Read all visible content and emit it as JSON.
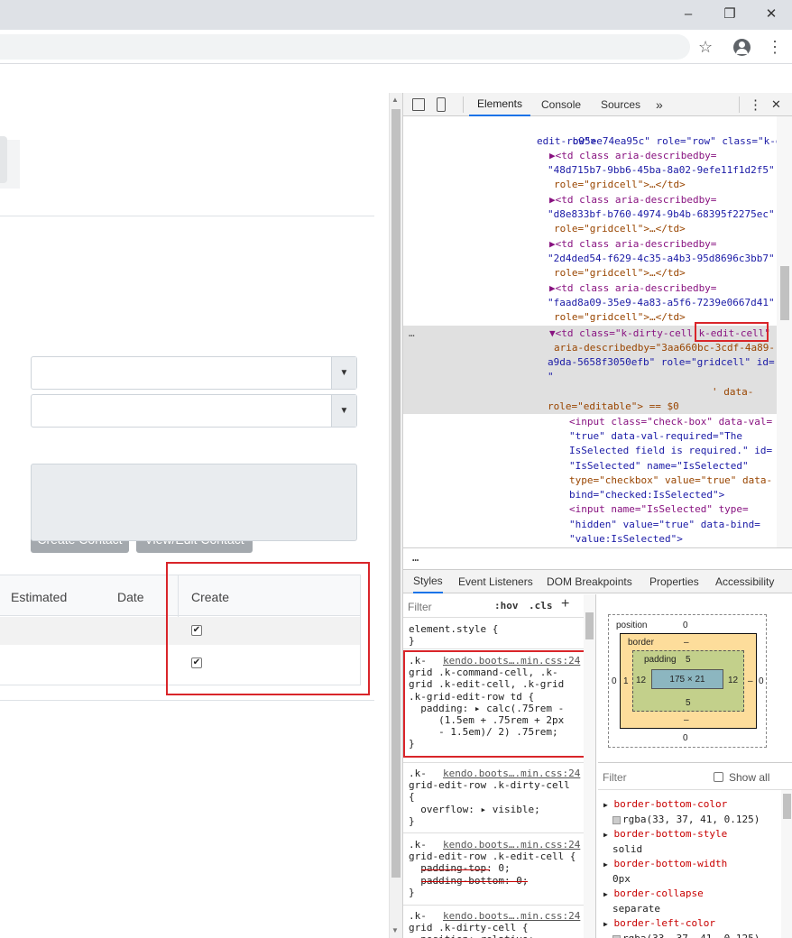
{
  "window": {
    "minimize": "–",
    "restore": "❐",
    "close": "✕"
  },
  "toolbar": {
    "star_icon": "☆",
    "menu_icon": "⋮"
  },
  "page": {
    "buttons": {
      "create_contact": "Create Contact",
      "view_edit_contact": "View/Edit Contact"
    },
    "grid": {
      "headers": [
        "Estimated",
        "Date",
        "Create"
      ],
      "rows": [
        {
          "create_checked": true
        },
        {
          "create_checked": true
        }
      ]
    }
  },
  "devtools": {
    "tabs": [
      "Elements",
      "Console",
      "Sources"
    ],
    "more": "»",
    "kebab": "⋮",
    "close": "✕",
    "elements": {
      "lines": [
        {
          "text": "b95ee74ea95c\" role=\"row\" class=\"k-grid-"
        },
        {
          "text": "edit-row\">"
        },
        {
          "text": "▶<td class aria-describedby="
        },
        {
          "text": "\"48d715b7-9bb6-45ba-8a02-9efe11f1d2f5\""
        },
        {
          "text": "role=\"gridcell\">…</td>"
        },
        {
          "text": "▶<td class aria-describedby="
        },
        {
          "text": "\"d8e833bf-b760-4974-9b4b-68395f2275ec\""
        },
        {
          "text": "role=\"gridcell\">…</td>"
        },
        {
          "text": "▶<td class aria-describedby="
        },
        {
          "text": "\"2d4ded54-f629-4c35-a4b3-95d8696c3bb7\""
        },
        {
          "text": "role=\"gridcell\">…</td>"
        },
        {
          "text": "▶<td class aria-describedby="
        },
        {
          "text": "\"faad8a09-35e9-4a83-a5f6-7239e0667d41\""
        },
        {
          "text": "role=\"gridcell\">…</td>"
        },
        {
          "text": "▼<td class=\"k-dirty-cell k-edit-cell\""
        },
        {
          "text": "aria-describedby=\"3aa660bc-3cdf-4a89-"
        },
        {
          "text": "a9da-5658f3050efb\" role=\"gridcell\" id="
        },
        {
          "text": "\""
        },
        {
          "text": "' data-"
        },
        {
          "text": "role=\"editable\"> == $0"
        },
        {
          "text": "<input class=\"check-box\" data-val="
        },
        {
          "text": "\"true\" data-val-required=\"The"
        },
        {
          "text": "IsSelected field is required.\" id="
        },
        {
          "text": "\"IsSelected\" name=\"IsSelected\""
        },
        {
          "text": "type=\"checkbox\" value=\"true\" data-"
        },
        {
          "text": "bind=\"checked:IsSelected\">"
        },
        {
          "text": "<input name=\"IsSelected\" type="
        },
        {
          "text": "\"hidden\" value=\"true\" data-bind="
        },
        {
          "text": "\"value:IsSelected\">"
        }
      ],
      "ellipsis": "…"
    },
    "subtabs": [
      "Styles",
      "Event Listeners",
      "DOM Breakpoints",
      "Properties",
      "Accessibility"
    ],
    "filter_placeholder": "Filter",
    "hov": ":hov",
    "cls": ".cls",
    "plus": "+",
    "styles": [
      {
        "text": "element.style {\n}"
      },
      {
        "src": "kendo.boots….min.css:24",
        "text": ".k-\ngrid .k-command-cell, .k-\ngrid .k-edit-cell, .k-grid\n.k-grid-edit-row td {\n  padding: ▸ calc(.75rem -\n     (1.5em + .75rem + 2px\n     - 1.5em)/ 2) .75rem;\n}"
      },
      {
        "src": "kendo.boots….min.css:24",
        "text": ".k-\ngrid-edit-row .k-dirty-cell\n{\n  overflow: ▸ visible;\n}"
      },
      {
        "src": "kendo.boots….min.css:24",
        "text": ".k-\ngrid-edit-row .k-edit-cell {\n  padding-top: 0;\n  padding-bottom: 0;\n}"
      },
      {
        "src": "kendo.boots….min.css:24",
        "text": ".k-\ngrid .k-dirty-cell {\n  position: relative;"
      }
    ],
    "boxmodel": {
      "position_label": "position",
      "position_value": "0",
      "border_label": "border",
      "border_value": "–",
      "padding_label": "padding",
      "padding_value": "5",
      "content": "175 × 21",
      "left_pos": "0",
      "right_pos": "0",
      "bottom_pos": "0",
      "left_border": "1",
      "right_border": "–",
      "left_padding": "12",
      "right_padding": "12",
      "bottom_padding": "5",
      "bottom_border": "–"
    },
    "computed": {
      "filter_placeholder": "Filter",
      "show_all": "Show all",
      "props": [
        {
          "name": "border-bottom-color",
          "value": "rgba(33, 37, 41, 0.125)"
        },
        {
          "name": "border-bottom-style",
          "value": "solid"
        },
        {
          "name": "border-bottom-width",
          "value": "0px"
        },
        {
          "name": "border-collapse",
          "value": "separate"
        },
        {
          "name": "border-left-color",
          "value": "rgba(33, 37, 41, 0.125)"
        }
      ]
    }
  }
}
